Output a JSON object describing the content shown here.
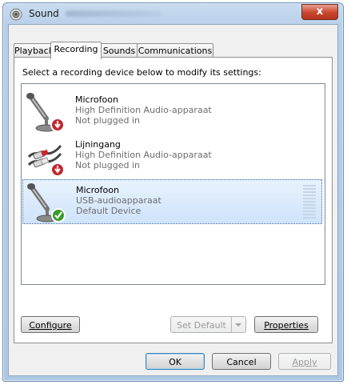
{
  "window": {
    "title": "Sound",
    "close_label": "x"
  },
  "tabs": [
    {
      "label": "Playback"
    },
    {
      "label": "Recording"
    },
    {
      "label": "Sounds"
    },
    {
      "label": "Communications"
    }
  ],
  "active_tab": "Recording",
  "instruction": "Select a recording device below to modify its settings:",
  "devices": [
    {
      "name": "Microfoon",
      "driver": "High Definition Audio-apparaat",
      "status": "Not plugged in",
      "icon": "microphone-icon",
      "badge": "unplugged-icon"
    },
    {
      "name": "Lijningang",
      "driver": "High Definition Audio-apparaat",
      "status": "Not plugged in",
      "icon": "line-in-cable-icon",
      "badge": "unplugged-icon"
    },
    {
      "name": "Microfoon",
      "driver": "USB-audioapparaat",
      "status": "Default Device",
      "icon": "microphone-icon",
      "badge": "default-check-icon",
      "selected": true,
      "level": 0
    }
  ],
  "buttons": {
    "configure": "Configure",
    "set_default": "Set Default",
    "properties": "Properties",
    "ok": "OK",
    "cancel": "Cancel",
    "apply": "Apply"
  },
  "colors": {
    "selection": "#cfe3fb",
    "unplugged_badge": "#c0282d",
    "default_badge": "#3a9b2a"
  }
}
